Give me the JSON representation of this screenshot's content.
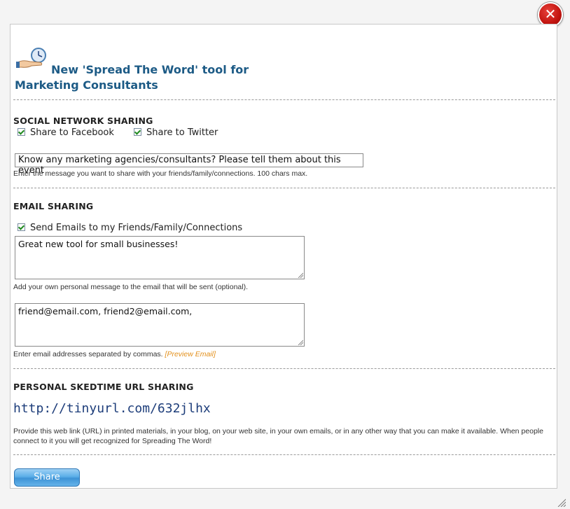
{
  "header": {
    "title": "New 'Spread The Word' tool for Marketing Consultants",
    "icon": "hand-clock-icon"
  },
  "social": {
    "section_title": "SOCIAL NETWORK SHARING",
    "facebook_label": "Share to Facebook",
    "facebook_checked": true,
    "twitter_label": "Share to Twitter",
    "twitter_checked": true,
    "message_value": "Know any marketing agencies/consultants?  Please tell them about this event",
    "message_hint": "Enter the message you want to share with your friends/family/connections. 100 chars max."
  },
  "email": {
    "section_title": "EMAIL SHARING",
    "send_label": "Send Emails to my Friends/Family/Connections",
    "send_checked": true,
    "personal_message": "Great new tool for small businesses!",
    "personal_hint": "Add your own personal message to the email that will be sent (optional).",
    "addresses": "friend@email.com, friend2@email.com,",
    "addresses_hint": "Enter email addresses separated by commas.",
    "preview_link": "[Preview Email]"
  },
  "url_sharing": {
    "section_title": "PERSONAL SKEDTIME URL SHARING",
    "url": "http://tinyurl.com/632jlhx",
    "description": "Provide this web link (URL) in printed materials, in your blog, on your web site, in your own emails, or in any other way that you can make it available. When people connect to it you will get recognized for Spreading The Word!"
  },
  "actions": {
    "share_label": "Share",
    "close_icon": "close-icon"
  },
  "colors": {
    "title": "#1d5b86",
    "url": "#1d3d7a",
    "preview_link": "#e3901c",
    "close": "#c2140f"
  }
}
